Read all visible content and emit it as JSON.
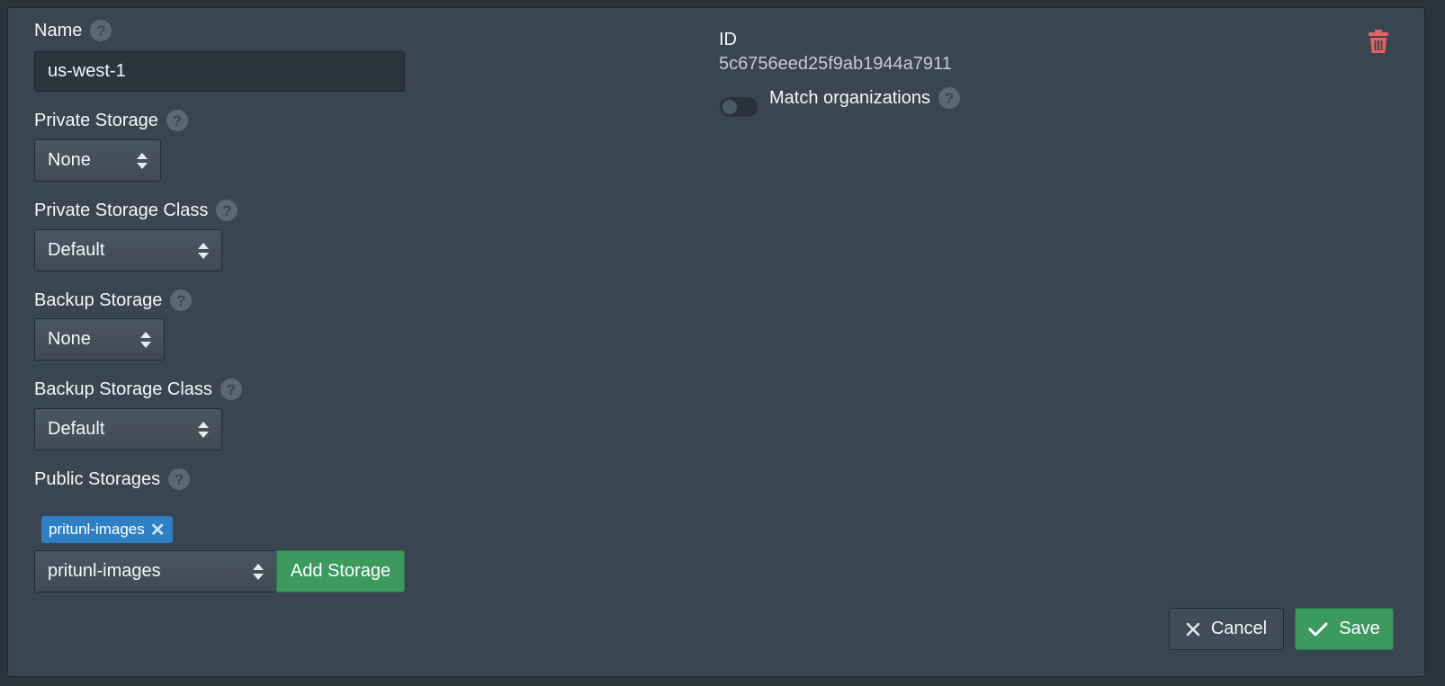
{
  "form": {
    "name": {
      "label": "Name",
      "value": "us-west-1"
    },
    "private_storage": {
      "label": "Private Storage",
      "selected": "None"
    },
    "private_storage_class": {
      "label": "Private Storage Class",
      "selected": "Default"
    },
    "backup_storage": {
      "label": "Backup Storage",
      "selected": "None"
    },
    "backup_storage_class": {
      "label": "Backup Storage Class",
      "selected": "Default"
    },
    "public_storages": {
      "label": "Public Storages",
      "tags": [
        "pritunl-images"
      ],
      "tag_remove": "✕",
      "selected": "pritunl-images",
      "add_label": "Add Storage"
    },
    "help_glyph": "?"
  },
  "info": {
    "id_label": "ID",
    "id_value": "5c6756eed25f9ab1944a7911",
    "match_orgs_label": "Match organizations",
    "match_orgs_on": false
  },
  "actions": {
    "cancel_label": "Cancel",
    "save_label": "Save"
  },
  "icons": {
    "delete": "trash-icon",
    "cancel": "close-icon",
    "save": "check-icon"
  },
  "colors": {
    "panel": "#394551",
    "accent_green": "#3c9a5f",
    "tag_blue": "#2f7fc4",
    "danger": "#e3635e"
  }
}
